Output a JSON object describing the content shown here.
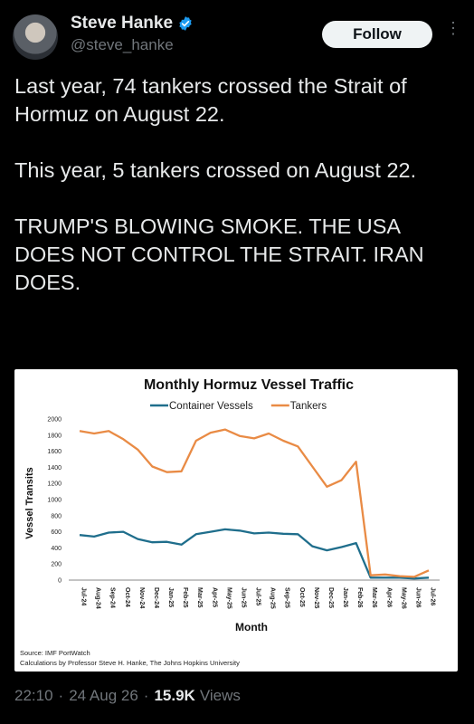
{
  "author": {
    "display_name": "Steve Hanke",
    "handle": "@steve_hanke",
    "verified_color": "#1d9bf0"
  },
  "follow_label": "Follow",
  "more_icon": "more-vertical-icon",
  "tweet": {
    "paragraphs": [
      "Last year, 74 tankers crossed the Strait of Hormuz on August 22.",
      "This year, 5 tankers crossed on August 22.",
      "TRUMP'S BLOWING SMOKE. THE USA DOES NOT CONTROL THE STRAIT. IRAN DOES."
    ]
  },
  "chart_data": {
    "type": "line",
    "title": "Monthly Hormuz Vessel Traffic",
    "xlabel": "Month",
    "ylabel": "Vessel Transits",
    "ylim": [
      0,
      2000
    ],
    "yticks": [
      0,
      200,
      400,
      600,
      800,
      1000,
      1200,
      1400,
      1600,
      1800,
      2000
    ],
    "grid": false,
    "legend_position": "top",
    "categories": [
      "Jul-24",
      "Aug-24",
      "Sep-24",
      "Oct-24",
      "Nov-24",
      "Dec-24",
      "Jan-25",
      "Feb-25",
      "Mar-25",
      "Apr-25",
      "May-25",
      "Jun-25",
      "Jul-25",
      "Aug-25",
      "Sep-25",
      "Oct-25",
      "Nov-25",
      "Dec-25",
      "Jan-26",
      "Feb-26",
      "Mar-26",
      "Apr-26",
      "May-26",
      "Jun-26",
      "Jul-26"
    ],
    "series": [
      {
        "name": "Container Vessels",
        "color": "#1f6e8c",
        "values": [
          560,
          540,
          590,
          600,
          510,
          470,
          475,
          440,
          570,
          600,
          630,
          615,
          580,
          590,
          575,
          570,
          420,
          370,
          410,
          460,
          30,
          30,
          30,
          20,
          30
        ]
      },
      {
        "name": "Tankers",
        "color": "#e98b45",
        "values": [
          1850,
          1820,
          1850,
          1750,
          1620,
          1410,
          1340,
          1350,
          1730,
          1830,
          1870,
          1790,
          1760,
          1820,
          1730,
          1660,
          1410,
          1160,
          1240,
          1470,
          60,
          70,
          50,
          40,
          120
        ]
      }
    ],
    "source": "Source: IMF PortWatch",
    "credit": "Calculations by Professor Steve H. Hanke, The Johns Hopkins University"
  },
  "meta": {
    "time": "22:10",
    "separator": "·",
    "date": "24 Aug 26",
    "views_count": "15.9K",
    "views_label": "Views"
  }
}
